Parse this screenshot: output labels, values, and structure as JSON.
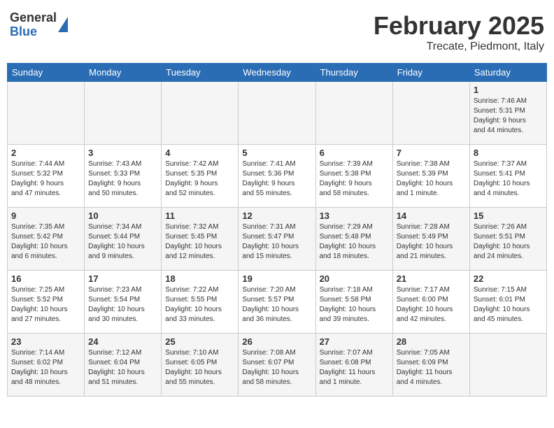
{
  "header": {
    "logo_general": "General",
    "logo_blue": "Blue",
    "month_year": "February 2025",
    "location": "Trecate, Piedmont, Italy"
  },
  "weekdays": [
    "Sunday",
    "Monday",
    "Tuesday",
    "Wednesday",
    "Thursday",
    "Friday",
    "Saturday"
  ],
  "weeks": [
    [
      {
        "day": "",
        "info": ""
      },
      {
        "day": "",
        "info": ""
      },
      {
        "day": "",
        "info": ""
      },
      {
        "day": "",
        "info": ""
      },
      {
        "day": "",
        "info": ""
      },
      {
        "day": "",
        "info": ""
      },
      {
        "day": "1",
        "info": "Sunrise: 7:46 AM\nSunset: 5:31 PM\nDaylight: 9 hours\nand 44 minutes."
      }
    ],
    [
      {
        "day": "2",
        "info": "Sunrise: 7:44 AM\nSunset: 5:32 PM\nDaylight: 9 hours\nand 47 minutes."
      },
      {
        "day": "3",
        "info": "Sunrise: 7:43 AM\nSunset: 5:33 PM\nDaylight: 9 hours\nand 50 minutes."
      },
      {
        "day": "4",
        "info": "Sunrise: 7:42 AM\nSunset: 5:35 PM\nDaylight: 9 hours\nand 52 minutes."
      },
      {
        "day": "5",
        "info": "Sunrise: 7:41 AM\nSunset: 5:36 PM\nDaylight: 9 hours\nand 55 minutes."
      },
      {
        "day": "6",
        "info": "Sunrise: 7:39 AM\nSunset: 5:38 PM\nDaylight: 9 hours\nand 58 minutes."
      },
      {
        "day": "7",
        "info": "Sunrise: 7:38 AM\nSunset: 5:39 PM\nDaylight: 10 hours\nand 1 minute."
      },
      {
        "day": "8",
        "info": "Sunrise: 7:37 AM\nSunset: 5:41 PM\nDaylight: 10 hours\nand 4 minutes."
      }
    ],
    [
      {
        "day": "9",
        "info": "Sunrise: 7:35 AM\nSunset: 5:42 PM\nDaylight: 10 hours\nand 6 minutes."
      },
      {
        "day": "10",
        "info": "Sunrise: 7:34 AM\nSunset: 5:44 PM\nDaylight: 10 hours\nand 9 minutes."
      },
      {
        "day": "11",
        "info": "Sunrise: 7:32 AM\nSunset: 5:45 PM\nDaylight: 10 hours\nand 12 minutes."
      },
      {
        "day": "12",
        "info": "Sunrise: 7:31 AM\nSunset: 5:47 PM\nDaylight: 10 hours\nand 15 minutes."
      },
      {
        "day": "13",
        "info": "Sunrise: 7:29 AM\nSunset: 5:48 PM\nDaylight: 10 hours\nand 18 minutes."
      },
      {
        "day": "14",
        "info": "Sunrise: 7:28 AM\nSunset: 5:49 PM\nDaylight: 10 hours\nand 21 minutes."
      },
      {
        "day": "15",
        "info": "Sunrise: 7:26 AM\nSunset: 5:51 PM\nDaylight: 10 hours\nand 24 minutes."
      }
    ],
    [
      {
        "day": "16",
        "info": "Sunrise: 7:25 AM\nSunset: 5:52 PM\nDaylight: 10 hours\nand 27 minutes."
      },
      {
        "day": "17",
        "info": "Sunrise: 7:23 AM\nSunset: 5:54 PM\nDaylight: 10 hours\nand 30 minutes."
      },
      {
        "day": "18",
        "info": "Sunrise: 7:22 AM\nSunset: 5:55 PM\nDaylight: 10 hours\nand 33 minutes."
      },
      {
        "day": "19",
        "info": "Sunrise: 7:20 AM\nSunset: 5:57 PM\nDaylight: 10 hours\nand 36 minutes."
      },
      {
        "day": "20",
        "info": "Sunrise: 7:18 AM\nSunset: 5:58 PM\nDaylight: 10 hours\nand 39 minutes."
      },
      {
        "day": "21",
        "info": "Sunrise: 7:17 AM\nSunset: 6:00 PM\nDaylight: 10 hours\nand 42 minutes."
      },
      {
        "day": "22",
        "info": "Sunrise: 7:15 AM\nSunset: 6:01 PM\nDaylight: 10 hours\nand 45 minutes."
      }
    ],
    [
      {
        "day": "23",
        "info": "Sunrise: 7:14 AM\nSunset: 6:02 PM\nDaylight: 10 hours\nand 48 minutes."
      },
      {
        "day": "24",
        "info": "Sunrise: 7:12 AM\nSunset: 6:04 PM\nDaylight: 10 hours\nand 51 minutes."
      },
      {
        "day": "25",
        "info": "Sunrise: 7:10 AM\nSunset: 6:05 PM\nDaylight: 10 hours\nand 55 minutes."
      },
      {
        "day": "26",
        "info": "Sunrise: 7:08 AM\nSunset: 6:07 PM\nDaylight: 10 hours\nand 58 minutes."
      },
      {
        "day": "27",
        "info": "Sunrise: 7:07 AM\nSunset: 6:08 PM\nDaylight: 11 hours\nand 1 minute."
      },
      {
        "day": "28",
        "info": "Sunrise: 7:05 AM\nSunset: 6:09 PM\nDaylight: 11 hours\nand 4 minutes."
      },
      {
        "day": "",
        "info": ""
      }
    ]
  ]
}
